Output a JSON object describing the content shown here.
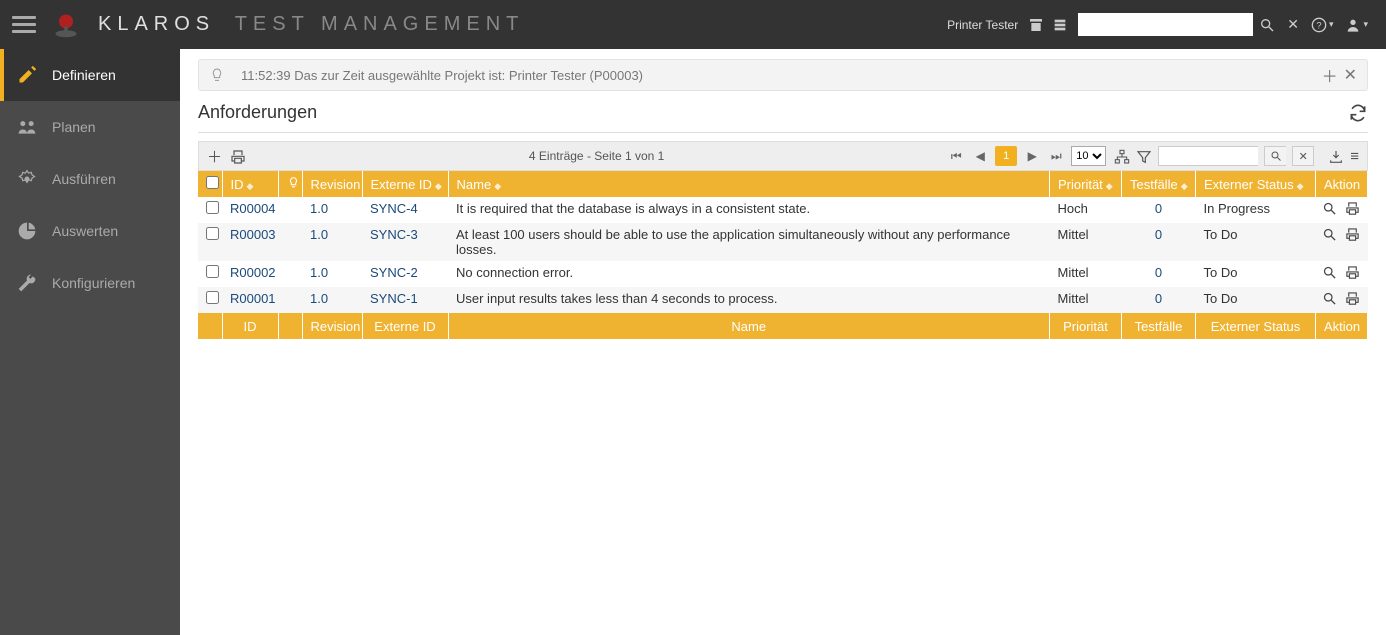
{
  "app": {
    "title_main": "KLAROS",
    "title_sub": "TEST MANAGEMENT"
  },
  "header": {
    "project_label": "Printer Tester"
  },
  "sidebar": {
    "items": [
      {
        "label": "Definieren",
        "active": true
      },
      {
        "label": "Planen",
        "active": false
      },
      {
        "label": "Ausführen",
        "active": false
      },
      {
        "label": "Auswerten",
        "active": false
      },
      {
        "label": "Konfigurieren",
        "active": false
      }
    ]
  },
  "notification": {
    "text": "11:52:39 Das zur Zeit ausgewählte Projekt ist: Printer Tester (P00003)"
  },
  "page": {
    "title": "Anforderungen"
  },
  "toolbar": {
    "page_info": "4 Einträge - Seite 1 von 1",
    "current_page": "1",
    "page_size": "10"
  },
  "table": {
    "headers": {
      "id": "ID",
      "revision": "Revision",
      "externe_id": "Externe ID",
      "name": "Name",
      "prioritaet": "Priorität",
      "testfaelle": "Testfälle",
      "externer_status": "Externer Status",
      "aktion": "Aktion"
    },
    "rows": [
      {
        "id": "R00004",
        "rev": "1.0",
        "ext": "SYNC-4",
        "name": "It is required that the database is always in a consistent state.",
        "pri": "Hoch",
        "tf": "0",
        "status": "In Progress"
      },
      {
        "id": "R00003",
        "rev": "1.0",
        "ext": "SYNC-3",
        "name": "At least 100 users should be able to use the application simultaneously without any performance losses.",
        "pri": "Mittel",
        "tf": "0",
        "status": "To Do"
      },
      {
        "id": "R00002",
        "rev": "1.0",
        "ext": "SYNC-2",
        "name": "No connection error.",
        "pri": "Mittel",
        "tf": "0",
        "status": "To Do"
      },
      {
        "id": "R00001",
        "rev": "1.0",
        "ext": "SYNC-1",
        "name": "User input results takes less than 4 seconds to process.",
        "pri": "Mittel",
        "tf": "0",
        "status": "To Do"
      }
    ]
  }
}
